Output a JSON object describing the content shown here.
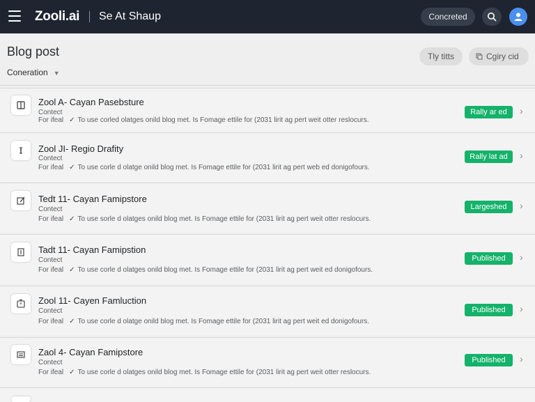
{
  "header": {
    "brand": "Zooli.ai",
    "app_title": "Se At Shaup",
    "pill_label": "Concreted"
  },
  "page": {
    "title": "Blog post",
    "subtitle": "Coneration",
    "subtitle_caret": "▼",
    "btn_tly": "Tly titts",
    "btn_copy": "Cgiry cid"
  },
  "colors": {
    "topbar": "#1e2430",
    "badge": "#14b26a",
    "avatar": "#4a90f0"
  },
  "rows": [
    {
      "icon": "book-icon",
      "title": "Zool A- Cayan Pasebsture",
      "category": "Contect",
      "meta_label": "For ifeal",
      "meta_text": "To use corled olatges onild blog met. Is Fomage ettile for (2031 lirit ag pert weit otter reslocurs.",
      "status": "Rally ar ed"
    },
    {
      "icon": "info-icon",
      "title": "Zool JI- Regio Drafity",
      "category": "Contect",
      "meta_label": "For ifeal",
      "meta_text": "To use corle d olatge onild blog met. Is Fomage ettile for (2031 lirit ag pert web ed donigofours.",
      "status": "Rally lat ad"
    },
    {
      "icon": "edit-icon",
      "title": "Tedt 11- Cayan Famipstore",
      "category": "Contect",
      "meta_label": "For ifeal",
      "meta_text": "To use sorle d olatges onild blog met. Is Fomage ettile for (2031 lirit ag pert weit otter reslocurs.",
      "status": "Largeshed"
    },
    {
      "icon": "doc-icon",
      "title": "Tadt 11- Cayan Famipstion",
      "category": "Contect",
      "meta_label": "For ifeal",
      "meta_text": "To use corle d olatges onild blog met. Is Fomage ettile for (2031 lirit ag pert weit ed donigofours.",
      "status": "Published"
    },
    {
      "icon": "clock-icon",
      "title": "Zool 11- Cayen Famluction",
      "category": "Contect",
      "meta_label": "For ifeal",
      "meta_text": "To use corle d olatge onild blog met. Is Fomage ettile for (2031 lirit ag pert weit ed donigofours.",
      "status": "Published"
    },
    {
      "icon": "list-icon",
      "title": "Zaol 4- Cayan Famipstore",
      "category": "Contect",
      "meta_label": "For ifeal",
      "meta_text": "To use corle d olatges onild blog met. Is Fomage ettile for (2031 lirit ag pert weit otter reslocurs.",
      "status": "Published"
    }
  ]
}
